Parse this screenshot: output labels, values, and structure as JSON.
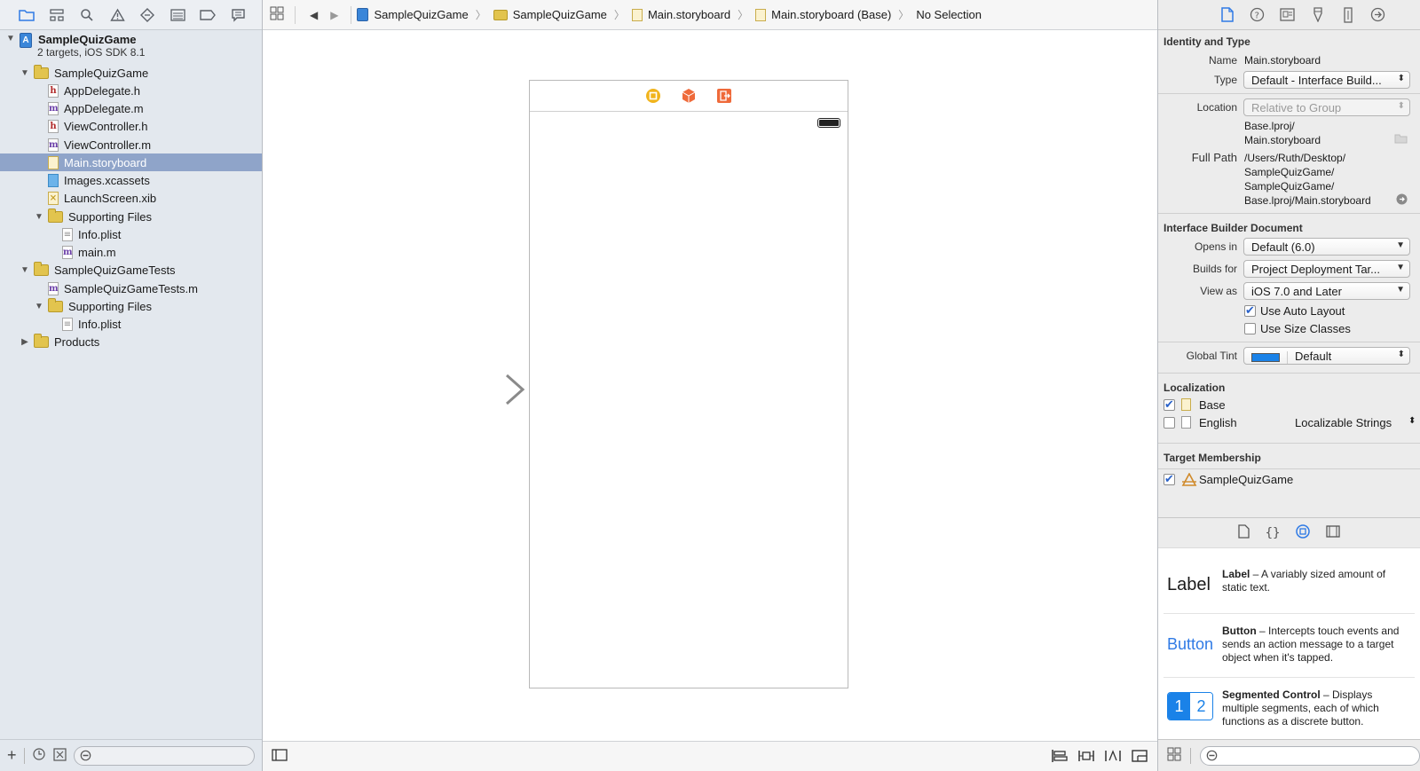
{
  "navigator": {
    "toolbar_icons": [
      "folder-icon",
      "hierarchy-icon",
      "search-icon",
      "warning-icon",
      "test-diamond-icon",
      "debug-list-icon",
      "breakpoint-icon",
      "report-icon"
    ],
    "project": {
      "name": "SampleQuizGame",
      "subtitle": "2 targets, iOS SDK 8.1"
    },
    "items": [
      {
        "label": "SampleQuizGame",
        "kind": "folder",
        "level": 1,
        "open": true
      },
      {
        "label": "AppDelegate.h",
        "kind": "h",
        "level": 2
      },
      {
        "label": "AppDelegate.m",
        "kind": "m",
        "level": 2
      },
      {
        "label": "ViewController.h",
        "kind": "h",
        "level": 2
      },
      {
        "label": "ViewController.m",
        "kind": "m",
        "level": 2
      },
      {
        "label": "Main.storyboard",
        "kind": "sb",
        "level": 2,
        "selected": true
      },
      {
        "label": "Images.xcassets",
        "kind": "xc",
        "level": 2
      },
      {
        "label": "LaunchScreen.xib",
        "kind": "xib",
        "level": 2
      },
      {
        "label": "Supporting Files",
        "kind": "folder",
        "level": 2,
        "open": true
      },
      {
        "label": "Info.plist",
        "kind": "pl",
        "level": 3
      },
      {
        "label": "main.m",
        "kind": "m",
        "level": 3
      },
      {
        "label": "SampleQuizGameTests",
        "kind": "folder",
        "level": 1,
        "open": true
      },
      {
        "label": "SampleQuizGameTests.m",
        "kind": "m",
        "level": 2
      },
      {
        "label": "Supporting Files",
        "kind": "folder",
        "level": 2,
        "open": true
      },
      {
        "label": "Info.plist",
        "kind": "pl",
        "level": 3
      },
      {
        "label": "Products",
        "kind": "folder",
        "level": 1,
        "open": false
      }
    ]
  },
  "jump_bar": {
    "crumbs": [
      "SampleQuizGame",
      "SampleQuizGame",
      "Main.storyboard",
      "Main.storyboard (Base)",
      "No Selection"
    ]
  },
  "inspector": {
    "identity": {
      "title": "Identity and Type",
      "name_label": "Name",
      "name_value": "Main.storyboard",
      "type_label": "Type",
      "type_value": "Default - Interface Build...",
      "location_label": "Location",
      "location_value": "Relative to Group",
      "location_path_1": "Base.lproj/",
      "location_path_2": "Main.storyboard",
      "full_path_label": "Full Path",
      "full_path_1": "/Users/Ruth/Desktop/",
      "full_path_2": "SampleQuizGame/",
      "full_path_3": "SampleQuizGame/",
      "full_path_4": "Base.lproj/Main.storyboard"
    },
    "ib_document": {
      "title": "Interface Builder Document",
      "opens_in_label": "Opens in",
      "opens_in_value": "Default (6.0)",
      "builds_for_label": "Builds for",
      "builds_for_value": "Project Deployment Tar...",
      "view_as_label": "View as",
      "view_as_value": "iOS 7.0 and Later",
      "auto_layout_label": "Use Auto Layout",
      "auto_layout_checked": true,
      "size_classes_label": "Use Size Classes",
      "size_classes_checked": false,
      "global_tint_label": "Global Tint",
      "global_tint_value": "Default",
      "global_tint_color": "#1a82e8"
    },
    "localization": {
      "title": "Localization",
      "base_label": "Base",
      "base_checked": true,
      "english_label": "English",
      "english_checked": false,
      "english_type": "Localizable Strings"
    },
    "target_membership": {
      "title": "Target Membership",
      "target_label": "SampleQuizGame",
      "target_checked": true
    }
  },
  "library": {
    "items": [
      {
        "preview": "Label",
        "title": "Label",
        "desc": " – A variably sized amount of static text."
      },
      {
        "preview": "Button",
        "title": "Button",
        "desc": " – Intercepts touch events and sends an action message to a target object when it's tapped."
      },
      {
        "preview_1": "1",
        "preview_2": "2",
        "title": "Segmented Control",
        "desc": " – Displays multiple segments, each of which functions as a discrete button."
      }
    ]
  },
  "colors": {
    "accent": "#2f7ae5",
    "selection": "#8fa4c9",
    "view_controller": "#f1b41c",
    "first_responder": "#ef6a3a",
    "exit": "#ef6a3a"
  }
}
